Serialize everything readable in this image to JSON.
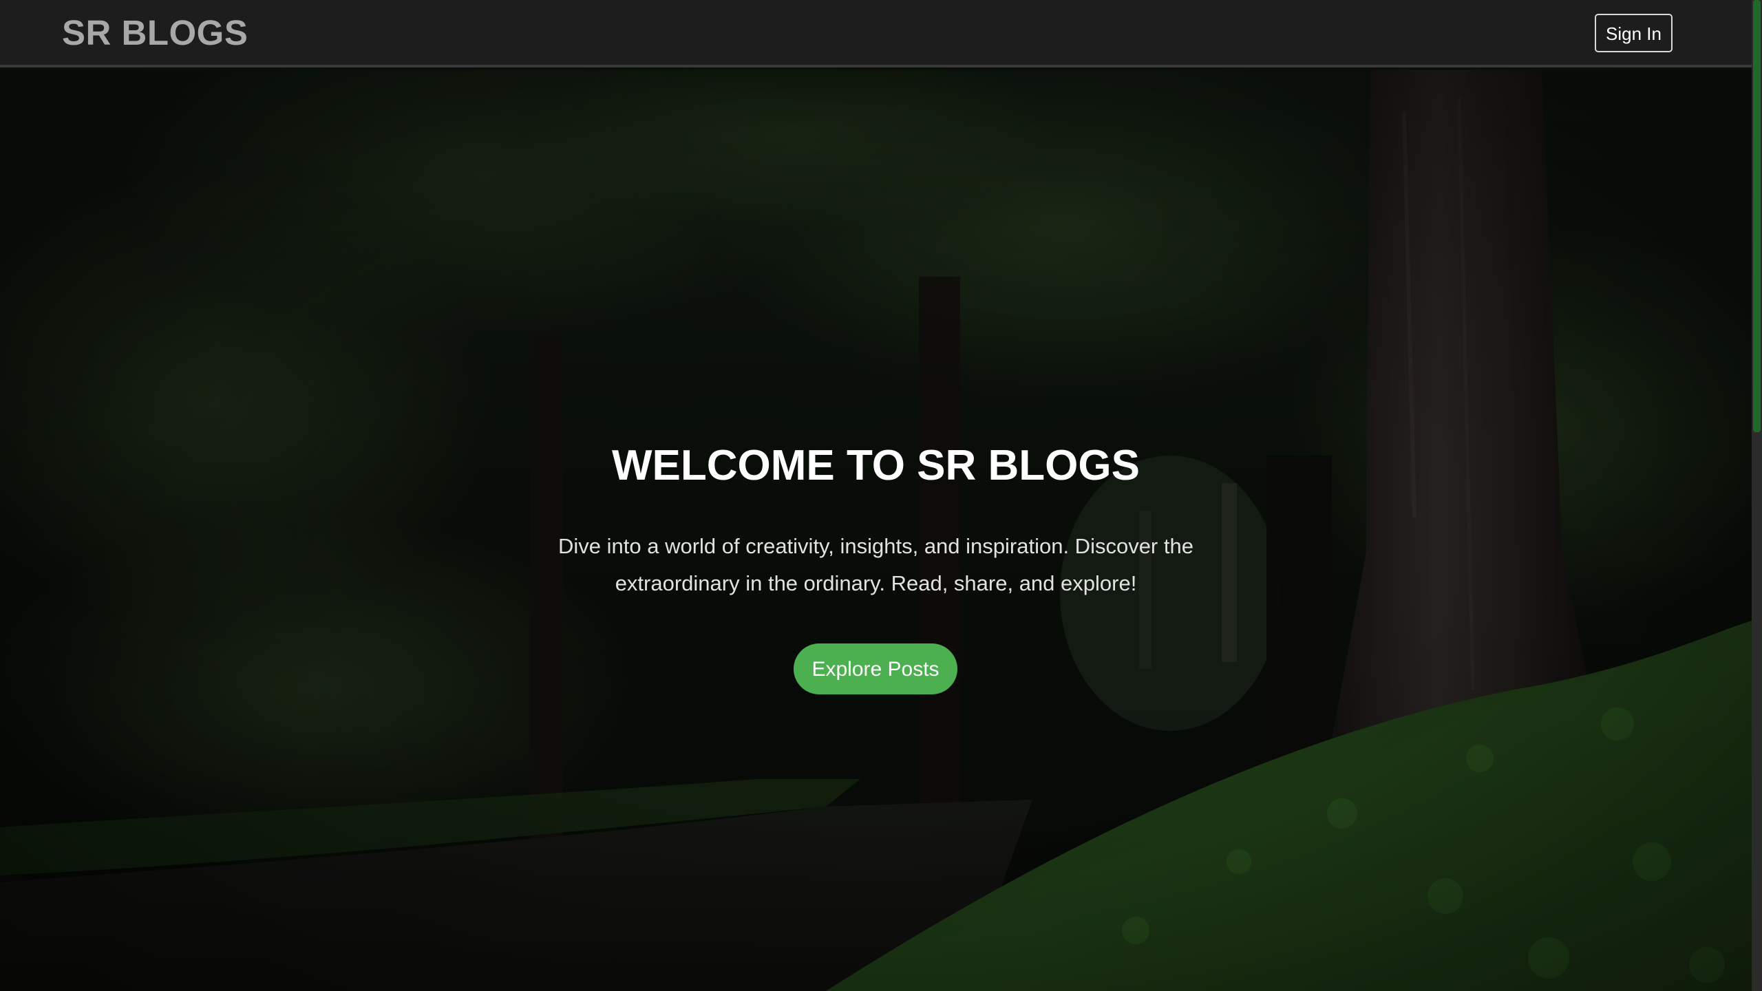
{
  "nav": {
    "brand": "SR BLOGS",
    "signin_label": "Sign In"
  },
  "hero": {
    "title": "WELCOME TO SR BLOGS",
    "subtitle": "Dive into a world of creativity, insights, and inspiration. Discover the extraordinary in the ordinary. Read, share, and explore!",
    "cta_label": "Explore Posts"
  },
  "colors": {
    "navbar_bg": "#1d1d1d",
    "brand_text": "#a8a8a8",
    "cta_bg": "#4caf50",
    "scrollbar_thumb": "#1f6a2a"
  }
}
